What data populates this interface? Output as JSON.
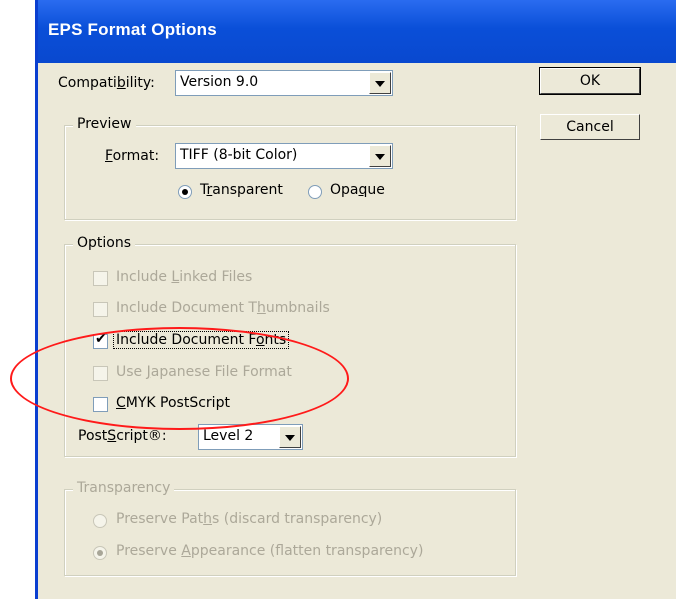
{
  "window": {
    "title": "EPS Format Options"
  },
  "buttons": {
    "ok": "OK",
    "cancel": "Cancel"
  },
  "compatibility": {
    "label_pre": "Compati",
    "label_accel": "b",
    "label_post": "ility:",
    "value": "Version 9.0"
  },
  "preview": {
    "legend": "Preview",
    "format_label_accel": "F",
    "format_label_rest": "ormat:",
    "format_value": "TIFF (8-bit Color)",
    "transparent_pre": "T",
    "transparent_accel": "r",
    "transparent_post": "ansparent",
    "opaque_pre": "Opa",
    "opaque_accel": "q",
    "opaque_post": "ue"
  },
  "options": {
    "legend": "Options",
    "linked_pre": "Include ",
    "linked_accel": "L",
    "linked_post": "inked Files",
    "thumbs_pre": "Include Document T",
    "thumbs_accel": "h",
    "thumbs_post": "umbnails",
    "fonts_pre": "Include Document F",
    "fonts_accel": "o",
    "fonts_post": "nts",
    "japanese_pre": "Use ",
    "japanese_accel": "J",
    "japanese_post": "apanese File Format",
    "cmyk_accel": "C",
    "cmyk_post": "MYK PostScript",
    "postscript_pre": "Post",
    "postscript_accel": "S",
    "postscript_post": "cript®:",
    "postscript_value": "Level 2"
  },
  "transparency": {
    "legend": "Transparency",
    "paths_pre": "Preserve Pat",
    "paths_accel": "h",
    "paths_post": "s (discard transparency)",
    "appearance_pre": "Preserve ",
    "appearance_accel": "A",
    "appearance_post": "ppearance (flatten transparency)"
  },
  "colors": {
    "title_bar": "#0a4fd8",
    "dialog_bg": "#ece9d8",
    "annotation": "#ff1a1a",
    "disabled_text": "#aca899"
  }
}
